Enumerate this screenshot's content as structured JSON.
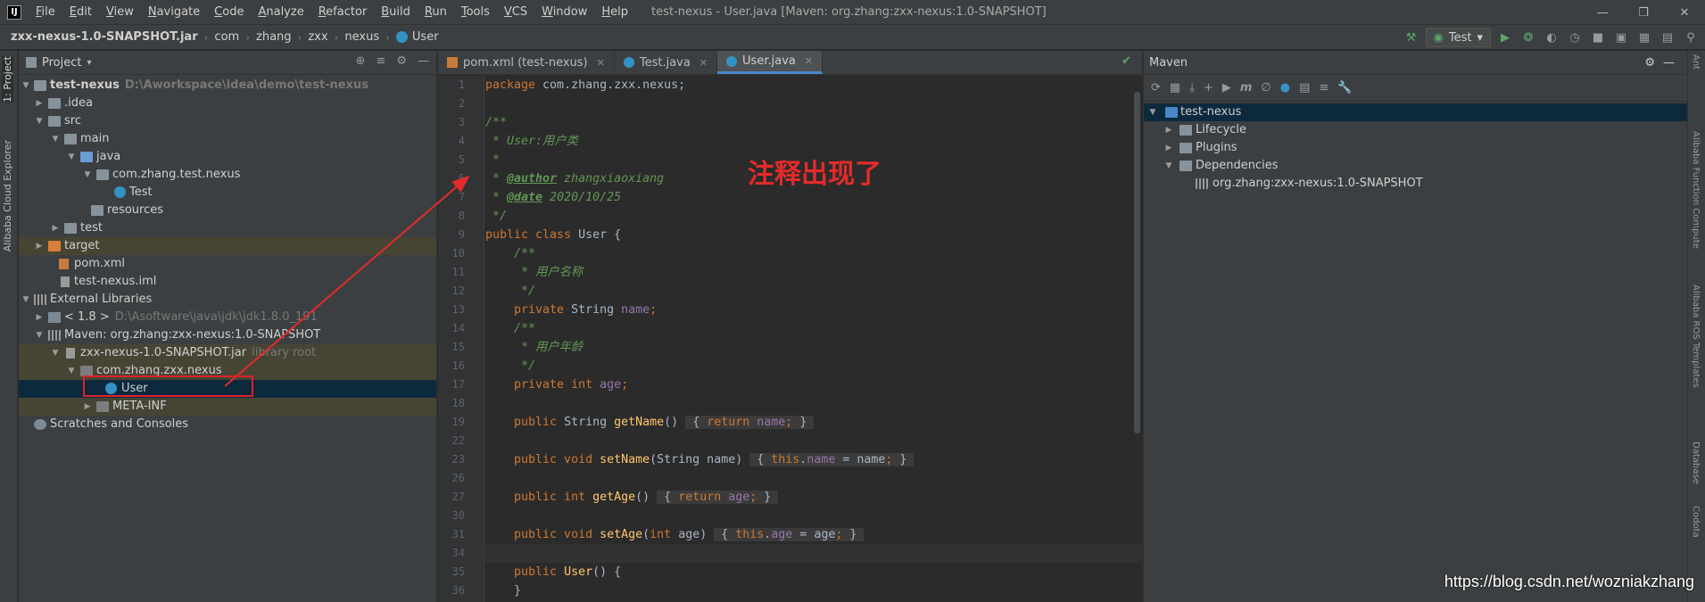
{
  "app": {
    "title": "test-nexus - User.java [Maven: org.zhang:zxx-nexus:1.0-SNAPSHOT]",
    "menus": [
      "File",
      "Edit",
      "View",
      "Navigate",
      "Code",
      "Analyze",
      "Refactor",
      "Build",
      "Run",
      "Tools",
      "VCS",
      "Window",
      "Help"
    ]
  },
  "breadcrumbs": [
    "zxx-nexus-1.0-SNAPSHOT.jar",
    "com",
    "zhang",
    "zxx",
    "nexus",
    "User"
  ],
  "toolbar": {
    "run_config": "Test"
  },
  "left_strip": {
    "project_tab": "1: Project",
    "cloud_tab": "Alibaba Cloud Explorer"
  },
  "right_strip": {
    "ant_tab": "Ant",
    "function_tab": "Alibaba Function Compute",
    "ros_tab": "Alibaba ROS Templates",
    "database_tab": "Database",
    "codota_tab": "Codota"
  },
  "project_panel": {
    "title": "Project",
    "tree": [
      {
        "label": "test-nexus",
        "hint": "D:\\Aworkspace\\idea\\demo\\test-nexus",
        "bold": true
      },
      {
        "label": ".idea"
      },
      {
        "label": "src"
      },
      {
        "label": "main"
      },
      {
        "label": "java"
      },
      {
        "label": "com.zhang.test.nexus"
      },
      {
        "label": "Test"
      },
      {
        "label": "resources"
      },
      {
        "label": "test"
      },
      {
        "label": "target"
      },
      {
        "label": "pom.xml"
      },
      {
        "label": "test-nexus.iml"
      },
      {
        "label": "External Libraries"
      },
      {
        "label": "< 1.8 >",
        "hint": "D:\\Asoftware\\java\\jdk\\jdk1.8.0_191"
      },
      {
        "label": "Maven: org.zhang:zxx-nexus:1.0-SNAPSHOT"
      },
      {
        "label": "zxx-nexus-1.0-SNAPSHOT.jar",
        "hint": "library root"
      },
      {
        "label": "com.zhang.zxx.nexus"
      },
      {
        "label": "User"
      },
      {
        "label": "META-INF"
      },
      {
        "label": "Scratches and Consoles"
      }
    ]
  },
  "editor": {
    "tabs": [
      {
        "label": "pom.xml (test-nexus)"
      },
      {
        "label": "Test.java"
      },
      {
        "label": "User.java"
      }
    ],
    "line_numbers": [
      "1",
      "2",
      "3",
      "4",
      "5",
      "6",
      "7",
      "8",
      "9",
      "10",
      "11",
      "12",
      "13",
      "14",
      "15",
      "16",
      "17",
      "18",
      "19",
      "22",
      "23",
      "26",
      "27",
      "30",
      "31",
      "34",
      "35",
      "36"
    ],
    "annotation": "注释出现了"
  },
  "maven": {
    "title": "Maven",
    "tree": [
      {
        "label": "test-nexus"
      },
      {
        "label": "Lifecycle"
      },
      {
        "label": "Plugins"
      },
      {
        "label": "Dependencies"
      },
      {
        "label": "org.zhang:zxx-nexus:1.0-SNAPSHOT"
      }
    ]
  },
  "watermark": "https://blog.csdn.net/wozniakzhang",
  "colors": {
    "accent": "#4a88c7",
    "annotation_red": "#e32b2b",
    "keyword": "#cc7832",
    "comment": "#629755"
  }
}
